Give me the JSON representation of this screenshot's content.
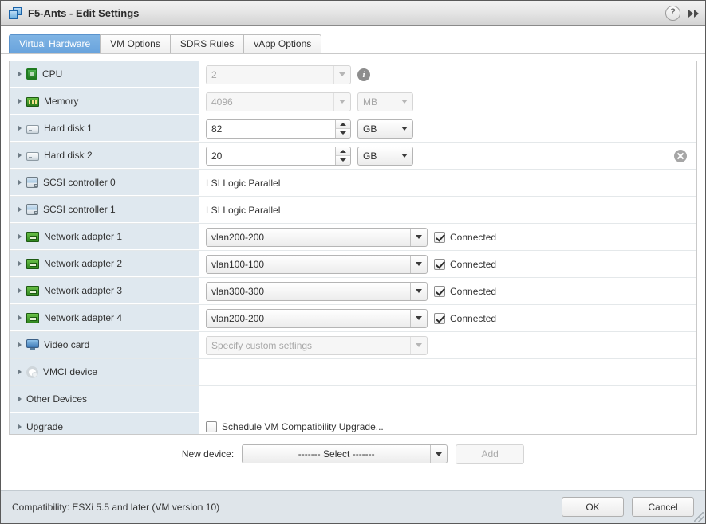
{
  "window": {
    "title": "F5-Ants - Edit Settings",
    "icon": "vm-icon",
    "help_label": "?",
    "expand_label": "▶▶"
  },
  "tabs": [
    {
      "label": "Virtual Hardware",
      "active": true
    },
    {
      "label": "VM Options",
      "active": false
    },
    {
      "label": "SDRS Rules",
      "active": false
    },
    {
      "label": "vApp Options",
      "active": false
    }
  ],
  "devices": [
    {
      "name": "CPU",
      "icon": "cpu-icon",
      "control": "combo",
      "value": "2",
      "disabled": true,
      "info": true
    },
    {
      "name": "Memory",
      "icon": "memory-icon",
      "control": "combo-unit",
      "value": "4096",
      "unit": "MB",
      "disabled": true
    },
    {
      "name": "Hard disk 1",
      "icon": "harddisk-icon",
      "control": "spinner-unit",
      "value": "82",
      "unit": "GB",
      "disabled": false
    },
    {
      "name": "Hard disk 2",
      "icon": "harddisk-icon",
      "control": "spinner-unit",
      "value": "20",
      "unit": "GB",
      "disabled": false,
      "removable": true
    },
    {
      "name": "SCSI controller 0",
      "icon": "scsi-controller-icon",
      "control": "text",
      "value": "LSI Logic Parallel"
    },
    {
      "name": "SCSI controller 1",
      "icon": "scsi-controller-icon",
      "control": "text",
      "value": "LSI Logic Parallel"
    },
    {
      "name": "Network adapter 1",
      "icon": "network-adapter-icon",
      "control": "combo-check",
      "value": "vlan200-200",
      "checkbox_label": "Connected",
      "checked": true
    },
    {
      "name": "Network adapter 2",
      "icon": "network-adapter-icon",
      "control": "combo-check",
      "value": "vlan100-100",
      "checkbox_label": "Connected",
      "checked": true
    },
    {
      "name": "Network adapter 3",
      "icon": "network-adapter-icon",
      "control": "combo-check",
      "value": "vlan300-300",
      "checkbox_label": "Connected",
      "checked": true
    },
    {
      "name": "Network adapter 4",
      "icon": "network-adapter-icon",
      "control": "combo-check",
      "value": "vlan200-200",
      "checkbox_label": "Connected",
      "checked": true
    },
    {
      "name": "Video card",
      "icon": "video-card-icon",
      "control": "combo",
      "value": "Specify custom settings",
      "disabled": true
    },
    {
      "name": "VMCI device",
      "icon": "vmci-device-icon",
      "control": "none",
      "value": ""
    },
    {
      "name": "Other Devices",
      "icon": "none",
      "control": "none",
      "value": ""
    },
    {
      "name": "Upgrade",
      "icon": "none",
      "control": "checkbox",
      "checkbox_label": "Schedule VM Compatibility Upgrade...",
      "checked": false
    }
  ],
  "new_device": {
    "label": "New device:",
    "selected": "------- Select -------",
    "add_label": "Add",
    "add_disabled": true
  },
  "footer": {
    "compatibility": "Compatibility: ESXi 5.5 and later (VM version 10)",
    "ok_label": "OK",
    "cancel_label": "Cancel"
  }
}
